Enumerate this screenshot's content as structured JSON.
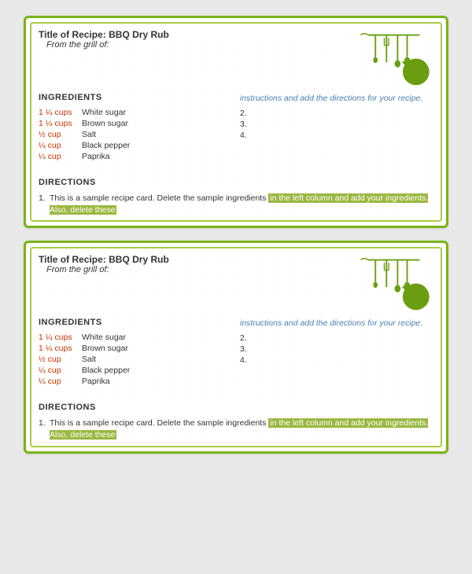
{
  "cards": [
    {
      "id": "card-1",
      "title": "Title of Recipe: BBQ Dry Rub",
      "from_grill_label": "From the grill of:",
      "ingredients_label": "INGREDIENTS",
      "ingredients": [
        {
          "amount": "1 ¼ cups",
          "name": "White sugar"
        },
        {
          "amount": "1 ¼ cups",
          "name": "Brown sugar"
        },
        {
          "amount": "½ cup",
          "name": "Salt"
        },
        {
          "amount": "¼ cup",
          "name": "Black pepper"
        },
        {
          "amount": "¼ cup",
          "name": "Paprika"
        }
      ],
      "instructions_text": "instructions and add the directions for your recipe.",
      "instructions_numbers": [
        "2.",
        "3.",
        "4."
      ],
      "directions_label": "DIRECTIONS",
      "directions": [
        {
          "num": "1.",
          "text_parts": [
            {
              "text": "This is a sample recipe card. Delete the sample ingredients ",
              "highlight": false
            },
            {
              "text": "in the left column and add your ingredients. Also, delete these",
              "highlight": true
            }
          ]
        }
      ]
    },
    {
      "id": "card-2",
      "title": "Title of Recipe: BBQ Dry Rub",
      "from_grill_label": "From the grill of:",
      "ingredients_label": "INGREDIENTS",
      "ingredients": [
        {
          "amount": "1 ¼ cups",
          "name": "White sugar"
        },
        {
          "amount": "1 ¼ cups",
          "name": "Brown sugar"
        },
        {
          "amount": "½ cup",
          "name": "Salt"
        },
        {
          "amount": "¼ cup",
          "name": "Black pepper"
        },
        {
          "amount": "¼ cup",
          "name": "Paprika"
        }
      ],
      "instructions_text": "instructions and add the directions for your recipe.",
      "instructions_numbers": [
        "2.",
        "3.",
        "4."
      ],
      "directions_label": "DIRECTIONS",
      "directions": [
        {
          "num": "1.",
          "text_parts": [
            {
              "text": "This is a sample recipe card. Delete the sample ingredients ",
              "highlight": false
            },
            {
              "text": "in the left column and add your ingredients. Also, delete these",
              "highlight": true
            }
          ]
        }
      ]
    }
  ]
}
